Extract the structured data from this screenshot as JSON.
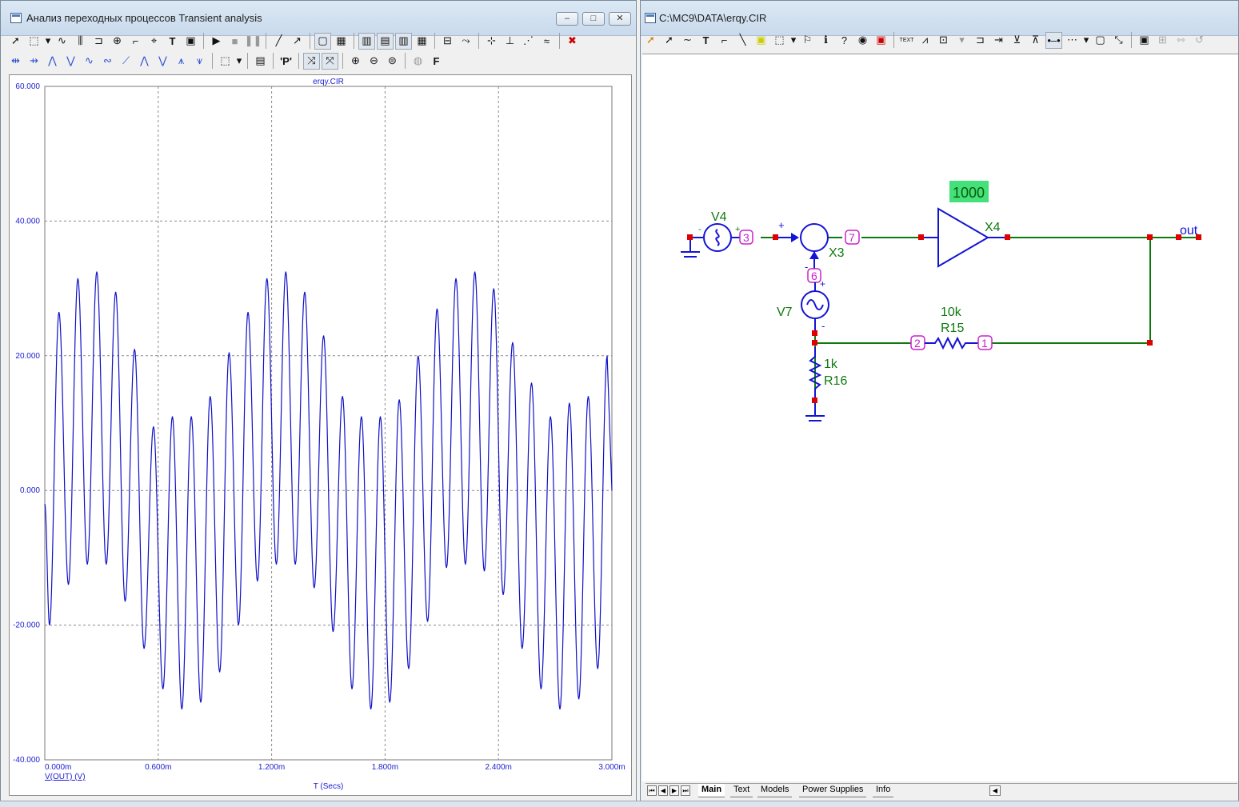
{
  "left_window": {
    "title": "Анализ переходных процессов Transient analysis",
    "caption_buttons": [
      "–",
      "□",
      "✕"
    ],
    "toolbar1": [
      "pointer-icon",
      "select-tool-icon",
      "dropdown-icon",
      "wave-icon",
      "bus-icon",
      "gate-icon",
      "source-icon",
      "hook-icon",
      "cursor-icon",
      "text-tool-icon",
      "properties-icon",
      "run-icon",
      "stop-icon",
      "pause-icon",
      "line-icon",
      "arrow-line-icon",
      "scale-icon",
      "grid-icon",
      "grid-minor-icon",
      "grid-major-icon",
      "grid-x-icon",
      "grid-y-icon",
      "baseline-icon",
      "tracker-icon",
      "peak-icon",
      "valley-icon",
      "slope-icon",
      "high-icon",
      "delete-icon"
    ],
    "toolbar2": [
      "cursor-left-icon",
      "cursor-right-icon",
      "peak-left-icon",
      "valley-icon",
      "high-icon",
      "low-icon",
      "inflection-icon",
      "global-high-icon",
      "global-low-icon",
      "top-icon",
      "bottom-icon",
      "data-point-icon",
      "dropdown-icon",
      "table-icon",
      "pointer-p-icon",
      "cursor-x-icon",
      "cursor-y-icon",
      "zoom-in-icon",
      "zoom-out-icon",
      "zoom-fit-icon",
      "help-icon",
      "font-icon"
    ],
    "plot": {
      "filename": "erqy.CIR",
      "y_tick_labels": [
        "60.000",
        "40.000",
        "20.000",
        "0.000",
        "-20.000",
        "-40.000"
      ],
      "x_tick_labels": [
        "0.000m",
        "0.600m",
        "1.200m",
        "1.800m",
        "2.400m",
        "3.000m"
      ],
      "trace_label": "V(OUT) (V)",
      "x_axis_label": "T (Secs)",
      "trace_color": "#1010c8"
    }
  },
  "chart_data": {
    "type": "line",
    "title": "erqy.CIR",
    "xlabel": "T (Secs)",
    "ylabel": "V(OUT) (V)",
    "xlim": [
      0,
      0.003
    ],
    "ylim": [
      -40,
      60
    ],
    "grid": true,
    "series": [
      {
        "name": "V(OUT) (V)",
        "color": "#1010c8",
        "description_of_signal": "AM-like sum of sinusoids: carrier ~10 kHz with envelope ~0.85 ms period, peaks ~32, troughs ~-32",
        "peaks": [
          {
            "t_ms": 0.0,
            "v": -2.0
          },
          {
            "t_ms": 0.075,
            "v": 26.5
          },
          {
            "t_ms": 0.175,
            "v": 31.5
          },
          {
            "t_ms": 0.275,
            "v": 32.5
          },
          {
            "t_ms": 0.375,
            "v": 29.5
          },
          {
            "t_ms": 0.475,
            "v": 21.0
          },
          {
            "t_ms": 0.575,
            "v": 9.5
          },
          {
            "t_ms": 0.675,
            "v": 11.0
          },
          {
            "t_ms": 0.775,
            "v": 11.0
          },
          {
            "t_ms": 0.875,
            "v": 14.0
          },
          {
            "t_ms": 0.975,
            "v": 20.5
          },
          {
            "t_ms": 1.075,
            "v": 26.5
          },
          {
            "t_ms": 1.175,
            "v": 31.5
          },
          {
            "t_ms": 1.275,
            "v": 32.5
          },
          {
            "t_ms": 1.375,
            "v": 29.5
          },
          {
            "t_ms": 1.475,
            "v": 23.0
          },
          {
            "t_ms": 1.575,
            "v": 14.0
          },
          {
            "t_ms": 1.675,
            "v": 11.0
          },
          {
            "t_ms": 1.775,
            "v": 11.0
          },
          {
            "t_ms": 1.875,
            "v": 13.5
          },
          {
            "t_ms": 1.975,
            "v": 20.0
          },
          {
            "t_ms": 2.075,
            "v": 27.0
          },
          {
            "t_ms": 2.175,
            "v": 31.5
          },
          {
            "t_ms": 2.275,
            "v": 32.5
          },
          {
            "t_ms": 2.375,
            "v": 30.0
          },
          {
            "t_ms": 2.475,
            "v": 22.0
          },
          {
            "t_ms": 2.575,
            "v": 16.0
          },
          {
            "t_ms": 2.675,
            "v": 11.0
          },
          {
            "t_ms": 2.775,
            "v": 13.0
          },
          {
            "t_ms": 2.875,
            "v": 14.0
          },
          {
            "t_ms": 2.975,
            "v": 20.0
          }
        ],
        "troughs": [
          {
            "t_ms": 0.025,
            "v": -20.0
          },
          {
            "t_ms": 0.125,
            "v": -14.0
          },
          {
            "t_ms": 0.225,
            "v": -11.0
          },
          {
            "t_ms": 0.325,
            "v": -11.0
          },
          {
            "t_ms": 0.425,
            "v": -16.5
          },
          {
            "t_ms": 0.525,
            "v": -23.5
          },
          {
            "t_ms": 0.625,
            "v": -29.5
          },
          {
            "t_ms": 0.725,
            "v": -32.5
          },
          {
            "t_ms": 0.825,
            "v": -31.5
          },
          {
            "t_ms": 0.925,
            "v": -27.0
          },
          {
            "t_ms": 1.025,
            "v": -20.0
          },
          {
            "t_ms": 1.125,
            "v": -13.5
          },
          {
            "t_ms": 1.225,
            "v": -11.0
          },
          {
            "t_ms": 1.325,
            "v": -11.0
          },
          {
            "t_ms": 1.425,
            "v": -14.5
          },
          {
            "t_ms": 1.525,
            "v": -21.0
          },
          {
            "t_ms": 1.625,
            "v": -29.5
          },
          {
            "t_ms": 1.725,
            "v": -32.5
          },
          {
            "t_ms": 1.825,
            "v": -31.5
          },
          {
            "t_ms": 1.925,
            "v": -26.5
          },
          {
            "t_ms": 2.025,
            "v": -19.5
          },
          {
            "t_ms": 2.125,
            "v": -11.5
          },
          {
            "t_ms": 2.225,
            "v": -11.0
          },
          {
            "t_ms": 2.325,
            "v": -12.0
          },
          {
            "t_ms": 2.425,
            "v": -15.5
          },
          {
            "t_ms": 2.525,
            "v": -23.5
          },
          {
            "t_ms": 2.625,
            "v": -29.5
          },
          {
            "t_ms": 2.725,
            "v": -32.5
          },
          {
            "t_ms": 2.825,
            "v": -31.0
          },
          {
            "t_ms": 2.925,
            "v": -26.5
          }
        ]
      }
    ]
  },
  "right_window": {
    "title": "C:\\MC9\\DATA\\erqy.CIR",
    "toolbar": [
      "select-mode-icon",
      "pointer-icon",
      "wire-icon",
      "text-tool-icon",
      "wire-diagonal-icon",
      "line-icon",
      "flag-icon",
      "component-icon",
      "dropdown-icon",
      "flag-off-icon",
      "info-icon",
      "help-icon",
      "properties-icon",
      "component-mode-icon",
      "text-mode-icon",
      "pin-icon",
      "grid-text-icon",
      "node-numbers-icon",
      "voltages-icon",
      "currents-icon",
      "power-icon",
      "conditions-icon",
      "pin-connections-icon",
      "grid-icon",
      "dropdown-icon",
      "border-icon",
      "title-icon",
      "properties-icon",
      "rotate-icon",
      "flip-x-icon",
      "flip-y-icon"
    ],
    "schematic": {
      "labels": {
        "v4": "V4",
        "v7": "V7",
        "x3": "X3",
        "x4": "X4",
        "gain": "1000",
        "r15_value": "10k",
        "r15_name": "R15",
        "r16_value": "1k",
        "r16_name": "R16",
        "out": "out",
        "plus_v4": "+",
        "minus_v4": "-",
        "plus_x3": "+",
        "minus_x3": "-",
        "plus_v7": "+",
        "minus_v7": "-"
      },
      "node_numbers": {
        "n3": "3",
        "n7": "7",
        "n6": "6",
        "n2": "2",
        "n1": "1"
      },
      "colors": {
        "wire": "#0e7a0e",
        "component": "#1414d4",
        "node_dot": "#e00000",
        "pin_label": "#cc22cc",
        "gain_bg": "#44e07a"
      }
    },
    "tabs": [
      "Main",
      "Text",
      "Models",
      "Power Supplies",
      "Info"
    ],
    "active_tab": "Main"
  }
}
